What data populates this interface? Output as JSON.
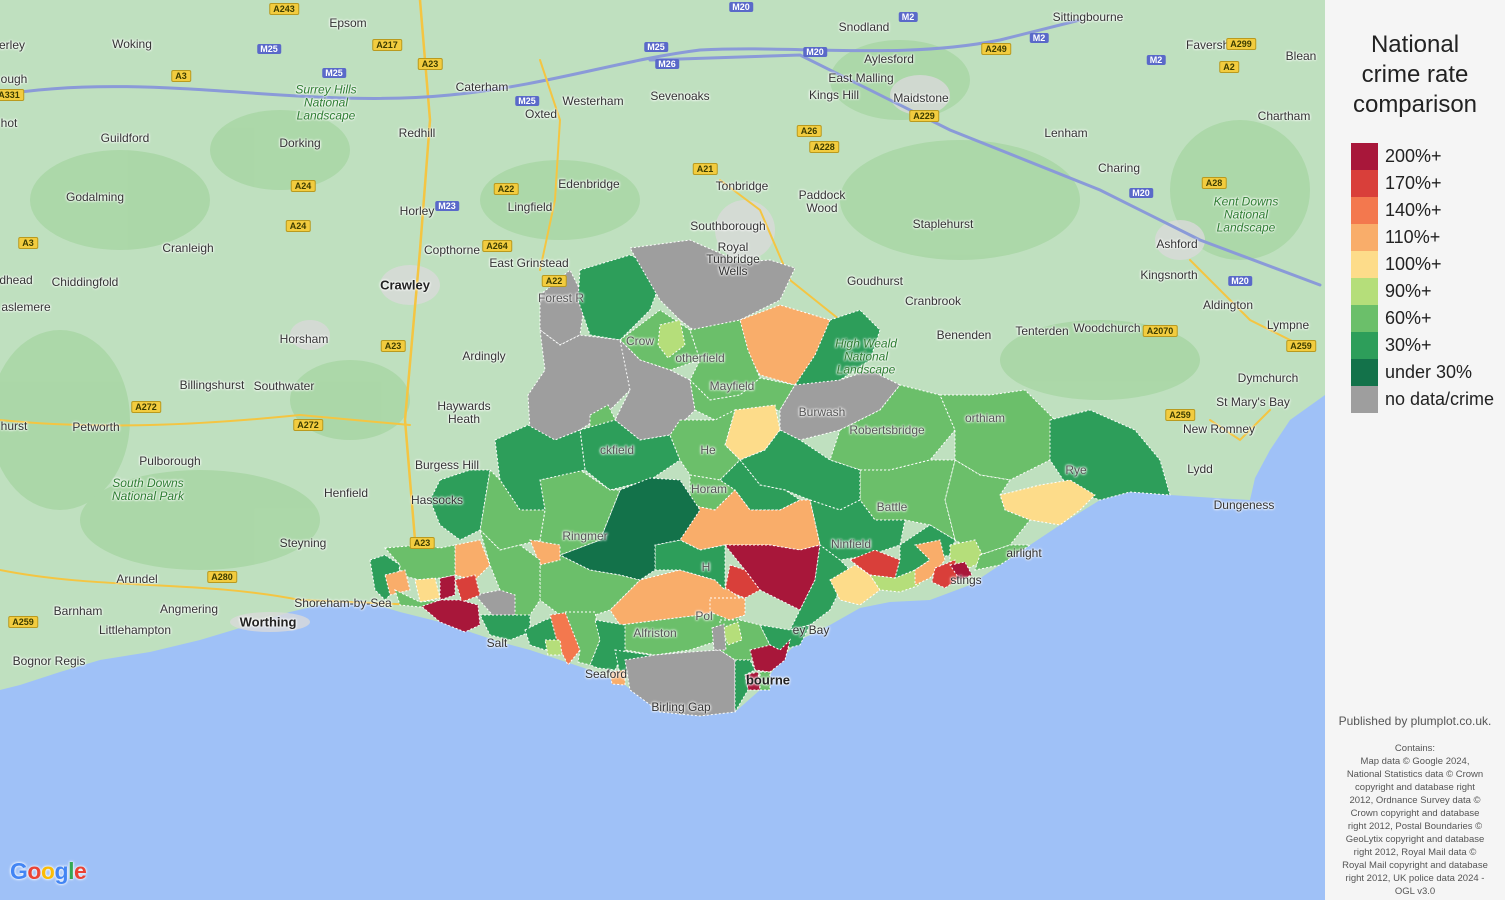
{
  "legend": {
    "title": "National\ncrime rate\ncomparison",
    "items": [
      {
        "label": "200%+",
        "color": "#a8173a"
      },
      {
        "label": "170%+",
        "color": "#d93f3a"
      },
      {
        "label": "140%+",
        "color": "#f3784e"
      },
      {
        "label": "110%+",
        "color": "#f9ad6a"
      },
      {
        "label": "100%+",
        "color": "#fddc8a"
      },
      {
        "label": "90%+",
        "color": "#b5de7a"
      },
      {
        "label": "60%+",
        "color": "#6bbf6a"
      },
      {
        "label": "30%+",
        "color": "#2d9e5a"
      },
      {
        "label": "under 30%",
        "color": "#13724a"
      },
      {
        "label": "no data/crime",
        "color": "#9e9e9e"
      }
    ]
  },
  "published": "Published by plumplot.co.uk.",
  "contains": "Contains:\nMap data © Google 2024,\nNational Statistics data © Crown\ncopyright and database right\n2012, Ordnance Survey data ©\nCrown copyright and database\nright 2012, Postal Boundaries ©\nGeoLytix copyright and database\nright 2012, Royal Mail data ©\nRoyal Mail copyright and database\nright 2012, UK police data 2024 -\nOGL v3.0",
  "google_logo": "Google",
  "places": {
    "epsom": "Epsom",
    "woking": "Woking",
    "guildford": "Guildford",
    "godalming": "Godalming",
    "cranleigh": "Cranleigh",
    "chiddingfold": "Chiddingfold",
    "haslemere": "aslemere",
    "dhead": "dhead",
    "caterham": "Caterham",
    "redhill": "Redhill",
    "dorking": "Dorking",
    "horley": "Horley",
    "copthorne": "Copthorne",
    "crawley": "Crawley",
    "horsham": "Horsham",
    "southwater": "Southwater",
    "billingshurst": "Billingshurst",
    "petworth": "Petworth",
    "pulborough": "Pulborough",
    "henfield": "Henfield",
    "steyning": "Steyning",
    "arundel": "Arundel",
    "barnham": "Barnham",
    "angmering": "Angmering",
    "littlehampton": "Littlehampton",
    "worthing": "Worthing",
    "bognor": "Bognor Regis",
    "shoreham": "Shoreham-by-Sea",
    "hassocks": "Hassocks",
    "burgess": "Burgess Hill",
    "haywards": "Haywards\nHeath",
    "ardingly": "Ardingly",
    "eastgrinstead": "East Grinstead",
    "lingfield": "Lingfield",
    "edenbridge": "Edenbridge",
    "oxted": "Oxted",
    "westerham": "Westerham",
    "sevenoaks": "Sevenoaks",
    "tonbridge": "Tonbridge",
    "southborough": "Southborough",
    "royaltw": "Royal\nTunbridge\nWells",
    "paddock": "Paddock\nWood",
    "snodland": "Snodland",
    "aylesford": "Aylesford",
    "eastmalling": "East Malling",
    "kingshill": "Kings Hill",
    "maidstone": "Maidstone",
    "sittingbourne": "Sittingbourne",
    "faversham": "Faversham",
    "blean": "Blean",
    "chartham": "Chartham",
    "lenham": "Lenham",
    "charing": "Charing",
    "ashford": "Ashford",
    "kingsnorth": "Kingsnorth",
    "aldington": "Aldington",
    "lympne": "Lympne",
    "dymchurch": "Dymchurch",
    "stmarys": "St Mary's Bay",
    "newromney": "New Romney",
    "lydd": "Lydd",
    "dungeness": "Dungeness",
    "woodchurch": "Woodchurch",
    "tenterden": "Tenterden",
    "benenden": "Benenden",
    "cranbrook": "Cranbrook",
    "goudhurst": "Goudhurst",
    "staplehurst": "Staplehurst",
    "seaford": "Seaford",
    "eastbourne": "bourne",
    "birling": "Birling Gap",
    "pevensey": "ey Bay",
    "hastings": "stings",
    "saltdean": "Salt",
    "fairlight": "airlight",
    "hurst": "hurst",
    "erley": "erley",
    "ough": "ough",
    "hot": "hot",
    "forestrow": "Forest R",
    "burwash": "Burwash",
    "mayfield": "Mayfield",
    "crowborough": "Crow",
    "robertsbridge": "Robertsbridge",
    "ninfield": "Ninfield",
    "battle": "Battle",
    "rye": "Rye",
    "northiam": "orthiam",
    "heathfield": "He",
    "alfriston": "Alfriston",
    "uckfield": "ckfield",
    "ringmer": "Ringmer",
    "rotherfield": "otherfield",
    "horam": "Horam",
    "hailsham": "H",
    "polegate": "Pol"
  },
  "parks": {
    "surrey": "Surrey Hills\nNational\nLandscape",
    "southdowns": "South Downs\nNational Park",
    "kentdowns": "Kent Downs\nNational\nLandscape",
    "highweald": "High Weald\nNational\nLandscape"
  },
  "roads": {
    "m20a": "M20",
    "m25a": "M25",
    "m25b": "M25",
    "m25c": "M25",
    "m26": "M26",
    "m25d": "M25",
    "m20b": "M20",
    "m2a": "M2",
    "m2b": "M2",
    "m2c": "M2",
    "m23": "M23",
    "m20c": "M20",
    "m20d": "M20",
    "a243": "A243",
    "a217": "A217",
    "a23a": "A23",
    "a3": "A3",
    "a331": "A331",
    "a24a": "A24",
    "a24b": "A24",
    "a3b": "A3",
    "a22a": "A22",
    "a264": "A264",
    "a22b": "A22",
    "a23b": "A23",
    "a272a": "A272",
    "a272b": "A272",
    "a280": "A280",
    "a259a": "A259",
    "a23c": "A23",
    "a21": "A21",
    "a26": "A26",
    "a228": "A228",
    "a229": "A229",
    "a249": "A249",
    "a299": "A299",
    "a2": "A2",
    "a28": "A28",
    "a2070": "A2070",
    "a259b": "A259",
    "a259c": "A259"
  }
}
